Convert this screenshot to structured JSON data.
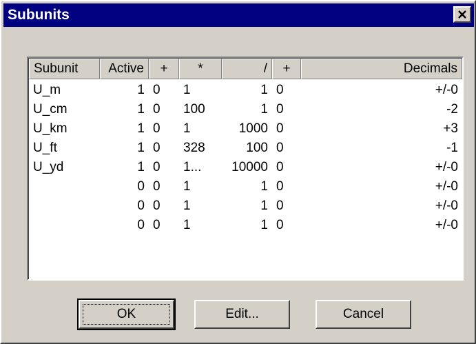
{
  "window": {
    "title": "Subunits"
  },
  "table": {
    "headers": [
      "Subunit",
      "Active",
      "+",
      "*",
      "/",
      "+",
      "Decimals"
    ],
    "rows": [
      [
        "U_m",
        "1",
        "0",
        "1",
        "1",
        "0",
        "+/-0"
      ],
      [
        "U_cm",
        "1",
        "0",
        "100",
        "1",
        "0",
        "-2"
      ],
      [
        "U_km",
        "1",
        "0",
        "1",
        "1000",
        "0",
        "+3"
      ],
      [
        "U_ft",
        "1",
        "0",
        "328",
        "100",
        "0",
        "-1"
      ],
      [
        "U_yd",
        "1",
        "0",
        "1...",
        "10000",
        "0",
        "+/-0"
      ],
      [
        "",
        "0",
        "0",
        "1",
        "1",
        "0",
        "+/-0"
      ],
      [
        "",
        "0",
        "0",
        "1",
        "1",
        "0",
        "+/-0"
      ],
      [
        "",
        "0",
        "0",
        "1",
        "1",
        "0",
        "+/-0"
      ]
    ]
  },
  "buttons": {
    "ok": "OK",
    "edit": "Edit...",
    "cancel": "Cancel"
  },
  "icons": {
    "close": "close-icon"
  },
  "colors": {
    "titlebar": "#000080",
    "face": "#d4d0c8",
    "list_bg": "#ffffff"
  }
}
